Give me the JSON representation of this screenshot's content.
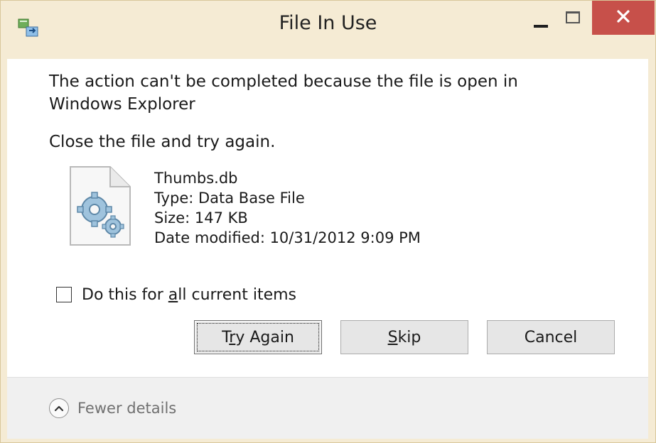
{
  "window": {
    "title": "File In Use",
    "colors": {
      "frame": "#f5ebd4",
      "close_button": "#c7504a",
      "content_bg": "#ffffff",
      "footer_bg": "#f0f0f0"
    }
  },
  "message": {
    "line1": "The action can't be completed because the file is open in Windows Explorer",
    "line2": "Close the file and try again."
  },
  "file": {
    "icon": "gears-file-icon",
    "name": "Thumbs.db",
    "type": "Type: Data Base File",
    "size": "Size: 147 KB",
    "date_modified": "Date modified: 10/31/2012 9:09 PM"
  },
  "checkbox": {
    "checked": false,
    "label_prefix": "Do this for ",
    "label_accel": "a",
    "label_suffix": "ll current items"
  },
  "buttons": {
    "try_again": {
      "prefix": "T",
      "accel": "r",
      "suffix": "y Again"
    },
    "skip": {
      "prefix": "",
      "accel": "S",
      "suffix": "kip"
    },
    "cancel": {
      "label": "Cancel"
    }
  },
  "footer": {
    "toggle_label": "Fewer details"
  }
}
